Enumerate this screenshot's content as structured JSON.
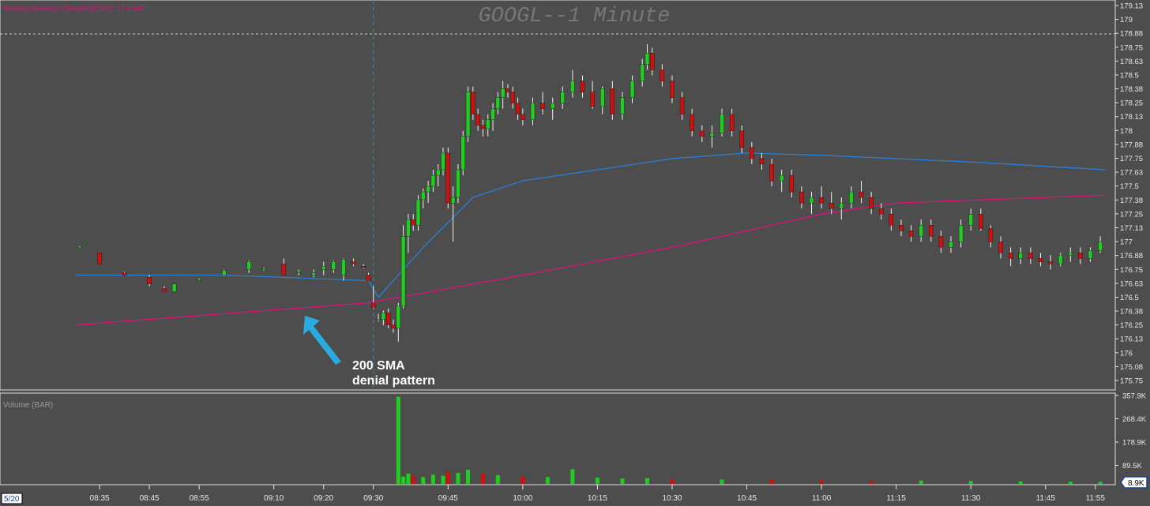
{
  "indicator_label": "Moving Average (Simple@200): 173.842",
  "title": "GOOGL--1 Minute",
  "volume_label": "Volume (BAR)",
  "annotation": {
    "line1": "200 SMA",
    "line2": "denial pattern"
  },
  "date_label": "5/20",
  "volume_last_badge": "8.9K",
  "price_ticks": [
    "179.13",
    "179",
    "178.88",
    "178.75",
    "178.63",
    "178.5",
    "178.38",
    "178.25",
    "178.13",
    "178",
    "177.88",
    "177.75",
    "177.63",
    "177.5",
    "177.38",
    "177.25",
    "177.13",
    "177",
    "176.88",
    "176.75",
    "176.63",
    "176.5",
    "176.38",
    "176.25",
    "176.13",
    "176",
    "175.08",
    "175.75"
  ],
  "volume_ticks": [
    "357.9K",
    "268.4K",
    "178.9K",
    "89.5K"
  ],
  "time_ticks": [
    "08:35",
    "08:45",
    "08:55",
    "09:10",
    "09:20",
    "09:30",
    "09:45",
    "10:00",
    "10:15",
    "10:30",
    "10:45",
    "11:00",
    "11:15",
    "11:30",
    "11:45",
    "11:55"
  ],
  "colors": {
    "bg": "#4d4d4d",
    "up": "#22cc22",
    "down": "#cc1111",
    "sma_blue": "#2a7fd4",
    "sma_magenta": "#e0107a",
    "label_magenta": "#e0107a",
    "arrow": "#29abe2",
    "axis_text": "#e8e8e8",
    "grid_dashed": "#d0d0d0"
  },
  "chart_data": {
    "type": "candlestick",
    "title": "GOOGL--1 Minute",
    "interval": "1 minute",
    "y_range": [
      175.7,
      179.15
    ],
    "volume_range": [
      0,
      360000
    ],
    "x_range": [
      "08:30",
      "11:57"
    ],
    "series": [
      {
        "name": "Moving Average (Simple@200)",
        "color": "#e0107a",
        "points": [
          [
            "08:30",
            176.25
          ],
          [
            "09:29",
            176.45
          ],
          [
            "10:00",
            176.7
          ],
          [
            "10:30",
            176.95
          ],
          [
            "11:00",
            177.25
          ],
          [
            "11:15",
            177.35
          ],
          [
            "11:57",
            177.42
          ]
        ]
      },
      {
        "name": "",
        "color": "#2a7fd4",
        "points": [
          [
            "08:30",
            176.7
          ],
          [
            "09:00",
            176.7
          ],
          [
            "09:29",
            176.65
          ],
          [
            "09:31",
            176.5
          ],
          [
            "09:40",
            176.95
          ],
          [
            "09:50",
            177.4
          ],
          [
            "10:00",
            177.55
          ],
          [
            "10:15",
            177.65
          ],
          [
            "10:30",
            177.75
          ],
          [
            "10:45",
            177.8
          ],
          [
            "11:00",
            177.78
          ],
          [
            "11:30",
            177.72
          ],
          [
            "11:57",
            177.65
          ]
        ]
      }
    ],
    "candles": [
      [
        "08:31",
        176.95,
        176.96,
        176.94,
        176.95
      ],
      [
        "08:32",
        177.0,
        177.0,
        176.99,
        177.0
      ],
      [
        "08:35",
        176.9,
        176.9,
        176.8,
        176.8
      ],
      [
        "08:40",
        176.72,
        176.73,
        176.7,
        176.7
      ],
      [
        "08:45",
        176.68,
        176.7,
        176.6,
        176.62
      ],
      [
        "08:48",
        176.58,
        176.6,
        176.55,
        176.55
      ],
      [
        "08:50",
        176.55,
        176.62,
        176.55,
        176.62
      ],
      [
        "08:55",
        176.66,
        176.67,
        176.65,
        176.66
      ],
      [
        "09:00",
        176.7,
        176.75,
        176.69,
        176.74
      ],
      [
        "09:05",
        176.75,
        176.83,
        176.72,
        176.82
      ],
      [
        "09:08",
        176.76,
        176.77,
        176.74,
        176.76
      ],
      [
        "09:12",
        176.8,
        176.85,
        176.7,
        176.7
      ],
      [
        "09:15",
        176.72,
        176.75,
        176.7,
        176.73
      ],
      [
        "09:18",
        176.7,
        176.75,
        176.68,
        176.72
      ],
      [
        "09:20",
        176.75,
        176.82,
        176.7,
        176.78
      ],
      [
        "09:22",
        176.75,
        176.83,
        176.72,
        176.82
      ],
      [
        "09:24",
        176.7,
        176.85,
        176.65,
        176.84
      ],
      [
        "09:26",
        176.82,
        176.85,
        176.78,
        176.8
      ],
      [
        "09:28",
        176.78,
        176.8,
        176.76,
        176.77
      ],
      [
        "09:29",
        176.7,
        176.72,
        176.65,
        176.65
      ],
      [
        "09:30",
        176.45,
        176.6,
        176.4,
        176.41
      ],
      [
        "09:31",
        176.3,
        176.35,
        176.28,
        176.3
      ],
      [
        "09:32",
        176.3,
        176.38,
        176.25,
        176.36
      ],
      [
        "09:33",
        176.36,
        176.4,
        176.22,
        176.25
      ],
      [
        "09:34",
        176.25,
        176.3,
        176.18,
        176.22
      ],
      [
        "09:35",
        176.22,
        176.45,
        176.1,
        176.42
      ],
      [
        "09:36",
        176.42,
        177.15,
        176.4,
        177.05
      ],
      [
        "09:37",
        177.05,
        177.25,
        176.9,
        177.2
      ],
      [
        "09:38",
        177.2,
        177.25,
        177.1,
        177.15
      ],
      [
        "09:39",
        177.15,
        177.42,
        177.1,
        177.38
      ],
      [
        "09:40",
        177.38,
        177.48,
        177.3,
        177.45
      ],
      [
        "09:41",
        177.45,
        177.55,
        177.35,
        177.5
      ],
      [
        "09:42",
        177.5,
        177.65,
        177.45,
        177.6
      ],
      [
        "09:43",
        177.6,
        177.7,
        177.5,
        177.65
      ],
      [
        "09:44",
        177.65,
        177.85,
        177.6,
        177.8
      ],
      [
        "09:45",
        177.8,
        177.85,
        177.3,
        177.35
      ],
      [
        "09:46",
        177.35,
        177.5,
        177.0,
        177.4
      ],
      [
        "09:47",
        177.4,
        177.7,
        177.35,
        177.65
      ],
      [
        "09:48",
        177.65,
        178.0,
        177.6,
        177.95
      ],
      [
        "09:49",
        177.95,
        178.4,
        177.9,
        178.35
      ],
      [
        "09:50",
        178.35,
        178.4,
        178.1,
        178.15
      ],
      [
        "09:51",
        178.15,
        178.2,
        178.0,
        178.05
      ],
      [
        "09:52",
        178.05,
        178.1,
        177.95,
        178.02
      ],
      [
        "09:53",
        178.02,
        178.15,
        177.95,
        178.1
      ],
      [
        "09:54",
        178.1,
        178.25,
        178.0,
        178.2
      ],
      [
        "09:55",
        178.2,
        178.35,
        178.15,
        178.3
      ],
      [
        "09:56",
        178.3,
        178.45,
        178.2,
        178.38
      ],
      [
        "09:57",
        178.38,
        178.42,
        178.3,
        178.35
      ],
      [
        "09:58",
        178.35,
        178.4,
        178.2,
        178.25
      ],
      [
        "09:59",
        178.25,
        178.3,
        178.1,
        178.15
      ],
      [
        "10:00",
        178.15,
        178.2,
        178.05,
        178.1
      ],
      [
        "10:02",
        178.1,
        178.3,
        178.05,
        178.25
      ],
      [
        "10:04",
        178.25,
        178.35,
        178.15,
        178.2
      ],
      [
        "10:06",
        178.2,
        178.3,
        178.1,
        178.25
      ],
      [
        "10:08",
        178.25,
        178.4,
        178.2,
        178.35
      ],
      [
        "10:10",
        178.35,
        178.55,
        178.3,
        178.45
      ],
      [
        "10:12",
        178.45,
        178.5,
        178.3,
        178.35
      ],
      [
        "10:14",
        178.35,
        178.45,
        178.2,
        178.22
      ],
      [
        "10:16",
        178.22,
        178.4,
        178.15,
        178.38
      ],
      [
        "10:18",
        178.38,
        178.45,
        178.1,
        178.15
      ],
      [
        "10:20",
        178.15,
        178.35,
        178.1,
        178.3
      ],
      [
        "10:22",
        178.3,
        178.5,
        178.25,
        178.45
      ],
      [
        "10:24",
        178.45,
        178.65,
        178.4,
        178.6
      ],
      [
        "10:25",
        178.6,
        178.78,
        178.55,
        178.7
      ],
      [
        "10:26",
        178.7,
        178.75,
        178.5,
        178.55
      ],
      [
        "10:28",
        178.55,
        178.6,
        178.4,
        178.45
      ],
      [
        "10:30",
        178.45,
        178.5,
        178.25,
        178.3
      ],
      [
        "10:32",
        178.3,
        178.35,
        178.1,
        178.15
      ],
      [
        "10:34",
        178.15,
        178.2,
        177.95,
        178.0
      ],
      [
        "10:36",
        178.0,
        178.05,
        177.9,
        177.95
      ],
      [
        "10:38",
        177.95,
        178.05,
        177.85,
        177.98
      ],
      [
        "10:40",
        177.98,
        178.2,
        177.95,
        178.15
      ],
      [
        "10:42",
        178.15,
        178.2,
        177.95,
        178.0
      ],
      [
        "10:44",
        178.0,
        178.05,
        177.8,
        177.85
      ],
      [
        "10:46",
        177.85,
        177.9,
        177.7,
        177.75
      ],
      [
        "10:48",
        177.75,
        177.8,
        177.65,
        177.7
      ],
      [
        "10:50",
        177.7,
        177.75,
        177.5,
        177.55
      ],
      [
        "10:52",
        177.55,
        177.65,
        177.45,
        177.6
      ],
      [
        "10:54",
        177.6,
        177.65,
        177.4,
        177.45
      ],
      [
        "10:56",
        177.45,
        177.5,
        177.3,
        177.35
      ],
      [
        "10:58",
        177.35,
        177.45,
        177.25,
        177.4
      ],
      [
        "11:00",
        177.4,
        177.5,
        177.3,
        177.35
      ],
      [
        "11:02",
        177.35,
        177.45,
        177.25,
        177.3
      ],
      [
        "11:04",
        177.3,
        177.4,
        177.2,
        177.35
      ],
      [
        "11:06",
        177.35,
        177.5,
        177.3,
        177.45
      ],
      [
        "11:08",
        177.45,
        177.55,
        177.35,
        177.4
      ],
      [
        "11:10",
        177.4,
        177.45,
        177.25,
        177.3
      ],
      [
        "11:12",
        177.3,
        177.35,
        177.2,
        177.25
      ],
      [
        "11:14",
        177.25,
        177.3,
        177.1,
        177.15
      ],
      [
        "11:16",
        177.15,
        177.2,
        177.05,
        177.1
      ],
      [
        "11:18",
        177.1,
        177.15,
        177.0,
        177.05
      ],
      [
        "11:20",
        177.05,
        177.2,
        177.0,
        177.15
      ],
      [
        "11:22",
        177.15,
        177.2,
        177.0,
        177.05
      ],
      [
        "11:24",
        177.05,
        177.1,
        176.9,
        176.95
      ],
      [
        "11:26",
        176.95,
        177.05,
        176.9,
        177.0
      ],
      [
        "11:28",
        177.0,
        177.2,
        176.95,
        177.15
      ],
      [
        "11:30",
        177.15,
        177.3,
        177.1,
        177.25
      ],
      [
        "11:32",
        177.25,
        177.3,
        177.1,
        177.12
      ],
      [
        "11:34",
        177.12,
        177.15,
        176.95,
        177.0
      ],
      [
        "11:36",
        177.0,
        177.05,
        176.85,
        176.9
      ],
      [
        "11:38",
        176.9,
        176.95,
        176.78,
        176.85
      ],
      [
        "11:40",
        176.85,
        176.95,
        176.8,
        176.9
      ],
      [
        "11:42",
        176.9,
        176.95,
        176.8,
        176.85
      ],
      [
        "11:44",
        176.85,
        176.9,
        176.78,
        176.82
      ],
      [
        "11:46",
        176.82,
        176.88,
        176.75,
        176.8
      ],
      [
        "11:48",
        176.8,
        176.9,
        176.78,
        176.88
      ],
      [
        "11:50",
        176.88,
        176.95,
        176.82,
        176.9
      ],
      [
        "11:52",
        176.9,
        176.95,
        176.8,
        176.85
      ],
      [
        "11:54",
        176.85,
        176.95,
        176.82,
        176.92
      ],
      [
        "11:56",
        176.92,
        177.05,
        176.9,
        177.0
      ]
    ],
    "volume": [
      [
        "09:35",
        357900
      ],
      [
        "09:36",
        30000
      ],
      [
        "09:37",
        42000
      ],
      [
        "09:38",
        35000
      ],
      [
        "09:40",
        28000
      ],
      [
        "09:42",
        38000
      ],
      [
        "09:44",
        33000
      ],
      [
        "09:45",
        52000
      ],
      [
        "09:47",
        45000
      ],
      [
        "09:49",
        58000
      ],
      [
        "09:52",
        42000
      ],
      [
        "09:55",
        36000
      ],
      [
        "10:00",
        30000
      ],
      [
        "10:05",
        28000
      ],
      [
        "10:10",
        60000
      ],
      [
        "10:15",
        26000
      ],
      [
        "10:20",
        22000
      ],
      [
        "10:25",
        24000
      ],
      [
        "10:30",
        20000
      ],
      [
        "10:40",
        18000
      ],
      [
        "10:50",
        16000
      ],
      [
        "11:00",
        15000
      ],
      [
        "11:10",
        13000
      ],
      [
        "11:20",
        14000
      ],
      [
        "11:30",
        12000
      ],
      [
        "11:40",
        10000
      ],
      [
        "11:50",
        9000
      ],
      [
        "11:56",
        8900
      ]
    ]
  }
}
